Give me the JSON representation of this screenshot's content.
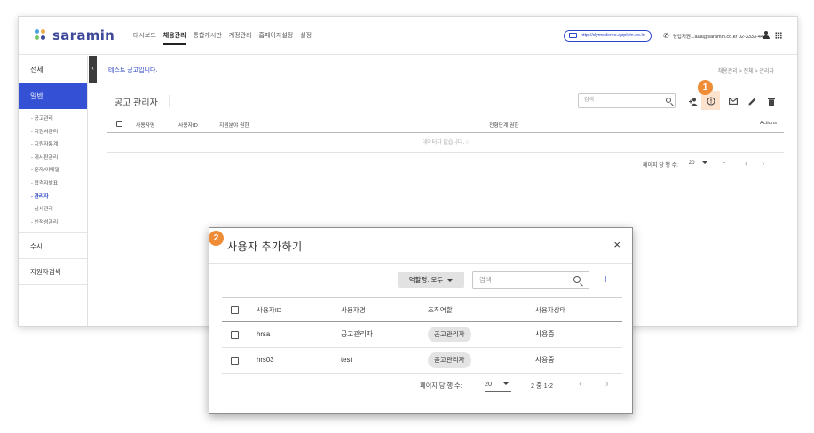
{
  "header": {
    "logo_text": "saramin",
    "nav": [
      "대시보드",
      "채용관리",
      "통합게시판",
      "계정관리",
      "홈페이지설정",
      "설정"
    ],
    "active_nav": "채용관리",
    "url": "http://dymsdemo.applyin.co.kr",
    "contact": "영업지원1.aaa@saramin.co.kr 02-3333-4444"
  },
  "sidebar": {
    "top": "전체",
    "active": "일반",
    "sub_items": [
      "공고관리",
      "지원서관리",
      "지원자통계",
      "게시판관리",
      "문자/이메일",
      "합격자발표",
      "관리자",
      "심사관리",
      "인적성관리"
    ],
    "current_sub": "관리자",
    "items": [
      "수시",
      "지원자검색"
    ],
    "collapse_glyph": "‹"
  },
  "main": {
    "notice": "테스트 공고입니다.",
    "breadcrumb": "채용관리 > 전체 > 관리자",
    "card_title": "공고 관리자",
    "search_placeholder": "검색",
    "columns": [
      "사용자명",
      "사용자ID",
      "지원분야 권한",
      "전형단계 권한",
      "Actions"
    ],
    "empty_text": "데이터가 없습니다.",
    "rows_per_page_label": "페이지 당 행 수:",
    "rows_per_page": "20",
    "range": "-",
    "badge": "1"
  },
  "modal": {
    "badge": "2",
    "title": "사용자 추가하기",
    "close_glyph": "×",
    "role_filter": "역할명: 모두",
    "search_placeholder": "검색",
    "add_glyph": "+",
    "columns": [
      "사용자ID",
      "사용자명",
      "조직역할",
      "사용자상태"
    ],
    "rows": [
      {
        "id": "hrsa",
        "name": "공고관리자",
        "role": "공고관리자",
        "status": "사용중"
      },
      {
        "id": "hrs03",
        "name": "test",
        "role": "공고관리자",
        "status": "사용중"
      }
    ],
    "rows_per_page_label": "페이지 당 행 수:",
    "rows_per_page": "20",
    "range": "2 중 1-2",
    "prev_glyph": "‹",
    "next_glyph": "›"
  },
  "colors": {
    "brand": "#3e4a99",
    "accent": "#3451d6",
    "highlight": "#ef8c37"
  }
}
